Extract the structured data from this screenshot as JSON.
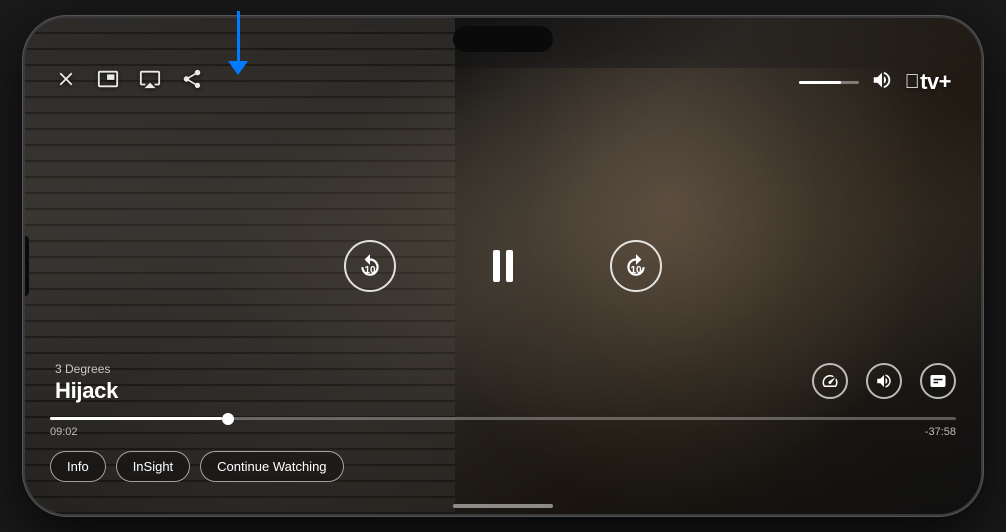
{
  "phone": {
    "title": "iPhone playing video"
  },
  "top_controls": {
    "close_label": "×",
    "pip_label": "pip",
    "airplay_label": "airplay",
    "share_label": "share",
    "apple_tv_logo": "tv+",
    "volume_percent": 70
  },
  "show": {
    "episode": "3 Degrees",
    "title": "Hijack"
  },
  "playback": {
    "rewind_seconds": "10",
    "forward_seconds": "10",
    "state": "paused"
  },
  "progress": {
    "current_time": "09:02",
    "remaining_time": "-37:58",
    "fill_percent": 19
  },
  "bottom_pills": [
    {
      "id": "info",
      "label": "Info"
    },
    {
      "id": "insight",
      "label": "InSight"
    },
    {
      "id": "continue",
      "label": "Continue Watching"
    }
  ],
  "right_controls": [
    {
      "id": "speed",
      "icon": "speed"
    },
    {
      "id": "audio",
      "icon": "audio"
    },
    {
      "id": "subtitles",
      "icon": "subtitles"
    }
  ],
  "colors": {
    "accent": "#007AFF",
    "text_primary": "#FFFFFF",
    "text_secondary": "rgba(255,255,255,0.7)",
    "progress_fill": "#FFFFFF"
  }
}
